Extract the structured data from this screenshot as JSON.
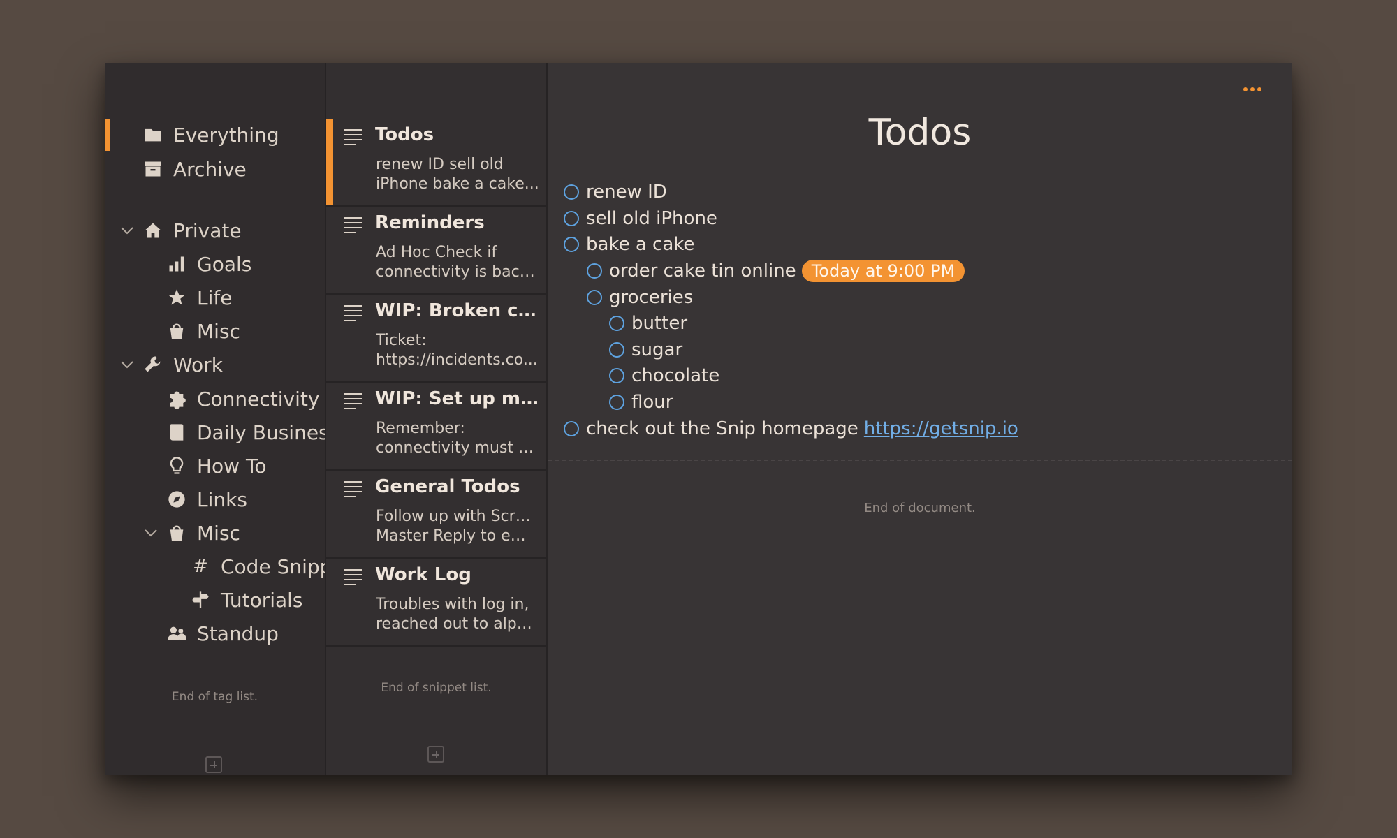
{
  "sidebar": {
    "items": [
      {
        "label": "Everything",
        "icon": "folder-icon"
      },
      {
        "label": "Archive",
        "icon": "archive-icon"
      },
      {
        "label": "Private",
        "icon": "home-icon"
      },
      {
        "label": "Goals",
        "icon": "bar-chart-icon"
      },
      {
        "label": "Life",
        "icon": "star-icon"
      },
      {
        "label": "Misc",
        "icon": "bucket-icon"
      },
      {
        "label": "Work",
        "icon": "wrench-icon"
      },
      {
        "label": "Connectivity",
        "icon": "puzzle-icon"
      },
      {
        "label": "Daily Business",
        "icon": "book-icon"
      },
      {
        "label": "How To",
        "icon": "lightbulb-icon"
      },
      {
        "label": "Links",
        "icon": "compass-icon"
      },
      {
        "label": "Misc",
        "icon": "bucket-icon"
      },
      {
        "label": "Code Snippets",
        "icon": "hash-icon"
      },
      {
        "label": "Tutorials",
        "icon": "signpost-icon"
      },
      {
        "label": "Standup",
        "icon": "people-icon"
      }
    ],
    "end_text": "End of tag list."
  },
  "snippets": {
    "items": [
      {
        "title": "Todos",
        "line1": "renew ID sell old",
        "line2": "iPhone bake a cake..."
      },
      {
        "title": "Reminders",
        "line1": "Ad Hoc Check if",
        "line2": "connectivity is back..."
      },
      {
        "title": "WIP: Broken cust...",
        "line1": "Ticket:",
        "line2": "https://incidents.co..."
      },
      {
        "title": "WIP: Set up moni...",
        "line1": "Remember:",
        "line2": "connectivity must be..."
      },
      {
        "title": "General Todos",
        "line1": "Follow up with Scrum",
        "line2": "Master Reply to emai..."
      },
      {
        "title": "Work Log",
        "line1": "Troubles with log in,",
        "line2": "reached out to alpha..."
      }
    ],
    "end_text": "End of snippet list."
  },
  "editor": {
    "title": "Todos",
    "todos": [
      {
        "text": "renew ID"
      },
      {
        "text": "sell old iPhone"
      },
      {
        "text": "bake a cake"
      },
      {
        "text": "order cake tin online",
        "reminder": "Today at 9:00 PM"
      },
      {
        "text": "groceries"
      },
      {
        "text": "butter"
      },
      {
        "text": "sugar"
      },
      {
        "text": "chocolate"
      },
      {
        "text": "flour"
      },
      {
        "text": "check out the Snip homepage",
        "link": "https://getsnip.io"
      }
    ],
    "end_text": "End of document."
  },
  "colors": {
    "accent": "#f39332",
    "checkbox": "#5ea2df",
    "link": "#72aee6"
  }
}
